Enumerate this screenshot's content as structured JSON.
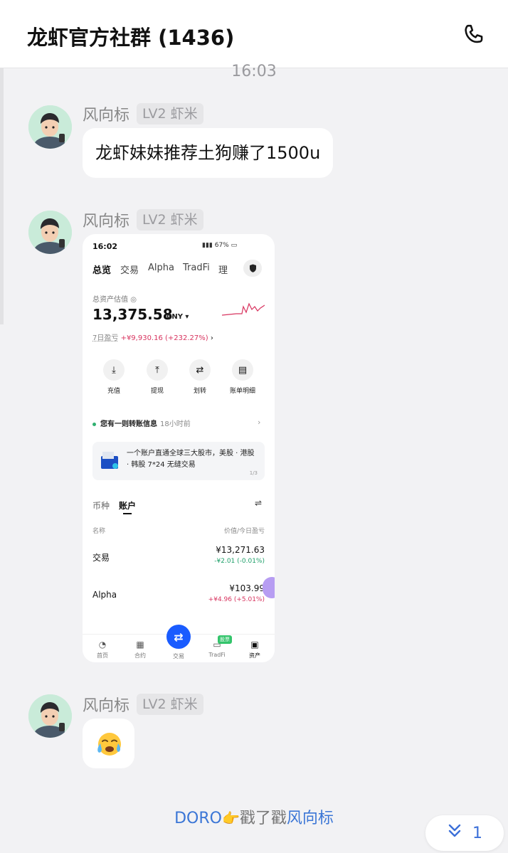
{
  "header": {
    "title": "龙虾官方社群 (1436)"
  },
  "separator_time": "16:03",
  "messages": [
    {
      "nick": "风向标",
      "level": "LV2 虾米",
      "text": "龙虾妹妹推荐土狗赚了1500u"
    },
    {
      "nick": "风向标",
      "level": "LV2 虾米"
    },
    {
      "nick": "风向标",
      "level": "LV2 虾米",
      "emoji": "😭"
    }
  ],
  "screenshot": {
    "status_time": "16:02",
    "status_battery": "67%",
    "tabs": [
      "总览",
      "交易",
      "Alpha",
      "TradFi",
      "理"
    ],
    "total_label": "总资产估值",
    "balance": "13,375.58",
    "currency": "CNY",
    "pnl_label": "7日盈亏",
    "pnl_value": "+¥9,930.16 (+232.27%)",
    "actions": [
      {
        "label": "充值",
        "icon": "download-icon",
        "glyph": "⤓"
      },
      {
        "label": "提现",
        "icon": "upload-icon",
        "glyph": "⤒"
      },
      {
        "label": "划转",
        "icon": "transfer-icon",
        "glyph": "⇄"
      },
      {
        "label": "账单明细",
        "icon": "bill-icon",
        "glyph": "▤"
      }
    ],
    "notice": "您有一则转账信息",
    "notice_time": "18小时前",
    "promo_text": "一个账户直通全球三大股市，美股 · 港股 · 韩股 7*24 无缝交易",
    "promo_page": "1/3",
    "subtabs": [
      "币种",
      "账户"
    ],
    "col_name": "名称",
    "col_value": "价值/今日盈亏",
    "rows": [
      {
        "name": "交易",
        "value": "¥13,271.63",
        "change": "-¥2.01 (-0.01%)",
        "dir": "neg"
      },
      {
        "name": "Alpha",
        "value": "¥103.99",
        "change": "+¥4.96 (+5.01%)",
        "dir": "pos"
      }
    ],
    "nav": [
      {
        "label": "首页",
        "glyph": "◔"
      },
      {
        "label": "合约",
        "glyph": "▦"
      },
      {
        "label": "交易",
        "glyph": "⇄"
      },
      {
        "label": "TradFi",
        "glyph": "▭"
      },
      {
        "label": "资产",
        "glyph": "▣"
      }
    ],
    "nav_badge": "股票"
  },
  "poke": {
    "actor": "DORO",
    "hand": "👉",
    "verb": "戳了戳",
    "target": "风向标"
  },
  "jump": {
    "count": "1"
  },
  "colors": {
    "accent": "#3b76d6",
    "positive": "#d8345f",
    "negative": "#1fa06a",
    "fab": "#1a5cff"
  }
}
